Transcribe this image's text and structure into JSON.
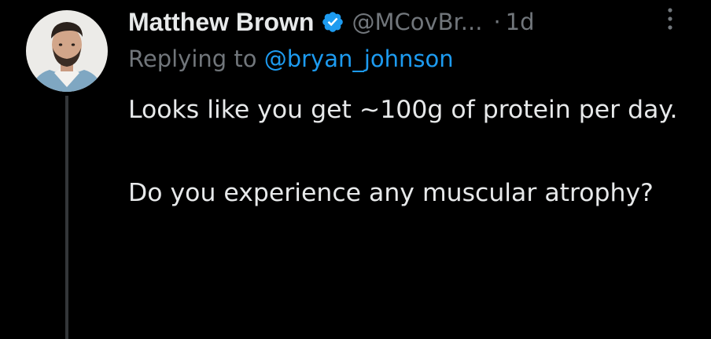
{
  "tweet": {
    "author": {
      "display_name": "Matthew Brown",
      "handle": "@MCovBr...",
      "verified": true,
      "avatar_icon": "user-avatar-photo"
    },
    "separator": "·",
    "timestamp": "1d",
    "replying_prefix": "Replying to",
    "replying_mention": "@bryan_johnson",
    "text_paragraphs": [
      "Looks like you get ~100g of protein per day.",
      "Do you experience any muscular atrophy?"
    ],
    "more_icon": "more-vertical-icon"
  },
  "colors": {
    "background": "#000000",
    "primary_text": "#e7e9ea",
    "secondary_text": "#71767b",
    "link": "#1d9bf0",
    "verified_badge": "#1d9bf0",
    "thread_line": "#333639"
  }
}
